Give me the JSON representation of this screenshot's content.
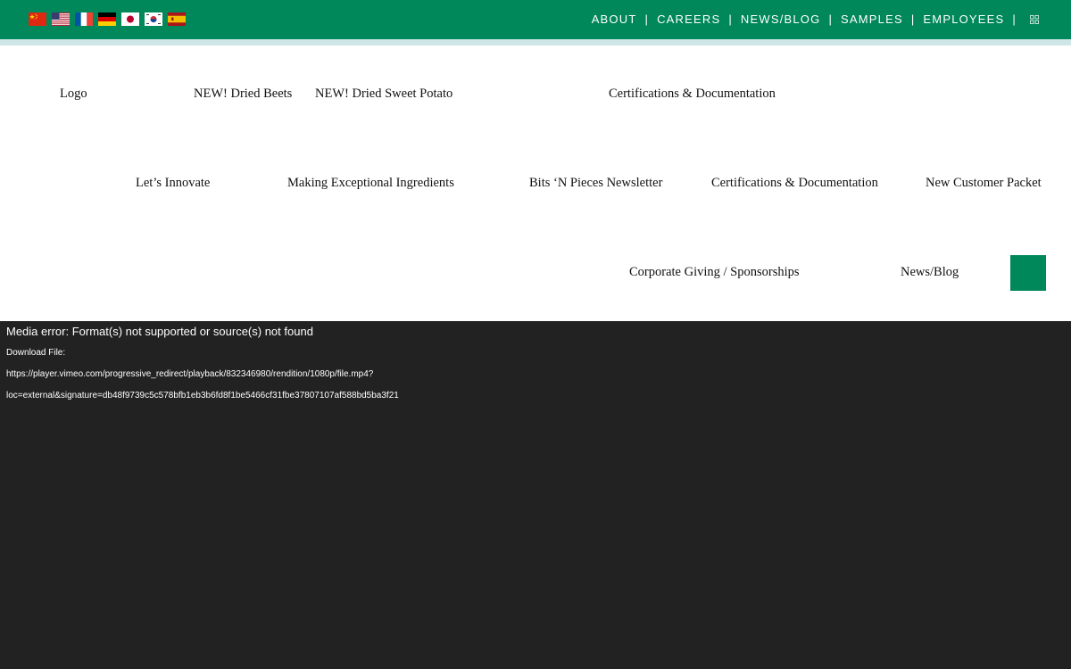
{
  "topbar": {
    "flags": [
      "china-flag",
      "usa-flag",
      "france-flag",
      "germany-flag",
      "japan-flag",
      "korea-flag",
      "spain-flag"
    ],
    "nav": [
      {
        "label": "ABOUT"
      },
      {
        "label": "CAREERS"
      },
      {
        "label": "NEWS/BLOG"
      },
      {
        "label": "SAMPLES"
      },
      {
        "label": "EMPLOYEES"
      }
    ],
    "separator": "|",
    "colors": {
      "bar": "#00875a",
      "strip": "#cfe6e6"
    }
  },
  "menu": {
    "logo": "Logo",
    "row1": [
      "NEW! Dried Beets",
      "NEW! Dried Sweet Potato",
      "Certifications & Documentation"
    ],
    "row2": [
      "Let’s Innovate",
      "Making Exceptional Ingredients",
      "Bits ‘N Pieces Newsletter",
      "Certifications & Documentation",
      "New Customer Packet"
    ],
    "row3": [
      "Corporate Giving / Sponsorships",
      "News/Blog"
    ]
  },
  "video": {
    "error": "Media error: Format(s) not supported or source(s) not found",
    "download_label": "Download File:",
    "url_line1": "https://player.vimeo.com/progressive_redirect/playback/832346980/rendition/1080p/file.mp4?",
    "url_line2": "loc=external&signature=db48f9739c5c578bfb1eb3b6fd8f1be5466cf31fbe37807107af588bd5ba3f21"
  }
}
